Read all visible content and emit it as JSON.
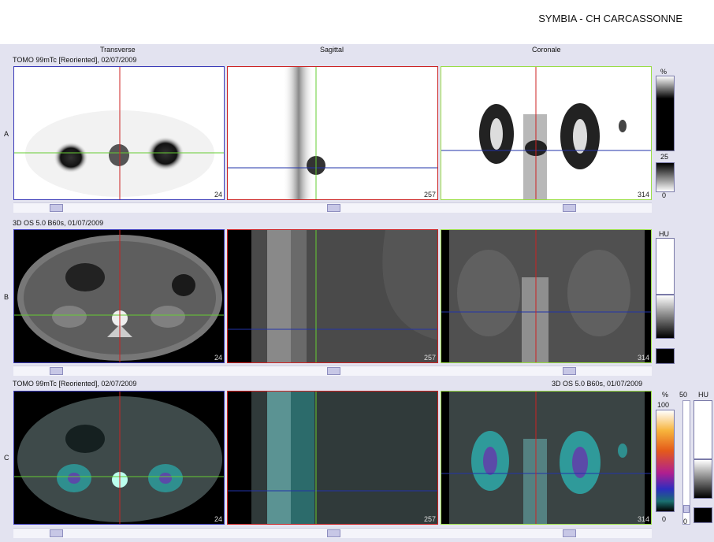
{
  "header": {
    "site": "SYMBIA - CH CARCASSONNE"
  },
  "columns": [
    "Transverse",
    "Sagittal",
    "Coronale"
  ],
  "rows": [
    {
      "label": "A",
      "series": "TOMO 99mTc [Reoriented], 02/07/2009"
    },
    {
      "label": "B",
      "series": "3D  OS  5.0  B60s, 01/07/2009"
    },
    {
      "label": "C",
      "series": "TOMO 99mTc [Reoriented], 02/07/2009",
      "series_right": "3D  OS  5.0  B60s, 01/07/2009"
    }
  ],
  "slices": [
    "24",
    "257",
    "314"
  ],
  "scales": {
    "a": {
      "unit": "%",
      "top": "25",
      "bottom": "0"
    },
    "b": {
      "unit": "HU"
    },
    "c": {
      "unit": "%",
      "top": "100",
      "bottom": "0",
      "window": "50",
      "unit2": "HU",
      "bottom2": "0"
    }
  },
  "colors": {
    "transverse_frame": "#3a3ab8",
    "sagittal_frame": "#cc2222",
    "coronal_frame": "#99dd44"
  }
}
